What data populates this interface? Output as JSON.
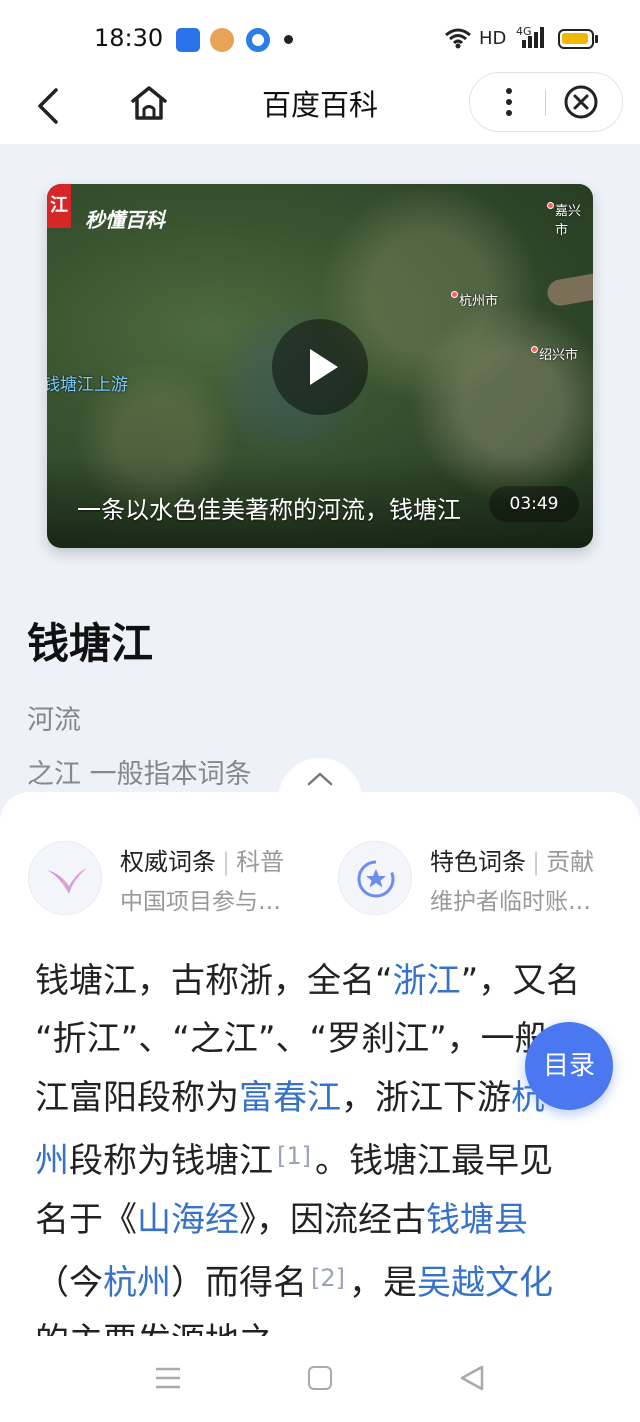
{
  "status_bar": {
    "time": "18:30",
    "network": "HD",
    "signal_label": "4G",
    "icons": [
      "app-notification-icon",
      "monkey-app-icon",
      "target-app-icon",
      "more-dot-icon",
      "wifi-icon",
      "signal-icon",
      "battery-icon"
    ]
  },
  "nav": {
    "title": "百度百科",
    "back_icon": "chevron-left-icon",
    "home_icon": "home-icon",
    "more_icon": "more-vertical-icon",
    "close_icon": "close-circle-icon"
  },
  "video": {
    "tag": "江",
    "logo": "秒懂百科",
    "map_labels": {
      "jiaxing": "嘉兴市",
      "hangzhou": "杭州市",
      "shaoxing": "绍兴市",
      "upstream": "钱塘江上游"
    },
    "caption": "一条以水色佳美著称的河流，钱塘江",
    "duration": "03:49"
  },
  "entry": {
    "title": "钱塘江",
    "type": "河流",
    "alias": "之江 一般指本词条"
  },
  "badges": {
    "left": {
      "title": "权威词条",
      "tag": "科普",
      "subtitle": "中国项目参与…"
    },
    "right": {
      "title": "特色词条",
      "tag": "贡献",
      "subtitle": "维护者临时账…"
    }
  },
  "article": {
    "l1_a": "钱塘江，古称浙，全名“",
    "l1_link": "浙江",
    "l1_b": "”，又名",
    "l2": "“折江”、“之江”、“罗刹江”，一般",
    "l3_a": "江富阳段称为",
    "l3_link": "富春江",
    "l3_b": "，浙江下游",
    "l3_link2": "杭",
    "l4_link": "州",
    "l4_a": "段称为钱塘江",
    "l4_ref": "[1]",
    "l4_b": "。钱塘江最早见",
    "l5_a": "名于《",
    "l5_link": "山海经",
    "l5_b": "》，因流经古",
    "l5_link2": "钱塘县",
    "l6_a": "（今",
    "l6_link": "杭州",
    "l6_b": "）而得名",
    "l6_ref": "[2]",
    "l6_c": "，是",
    "l6_link2": "吴越文化",
    "l7": "的主要发源地之"
  },
  "toc_button": "目录",
  "system_nav": {
    "menu_icon": "menu-icon",
    "home_icon": "square-home-icon",
    "back_icon": "triangle-back-icon"
  },
  "colors": {
    "link": "#3672c7",
    "toc_button": "#4a78f1",
    "page_bg": "#eef2f8"
  }
}
